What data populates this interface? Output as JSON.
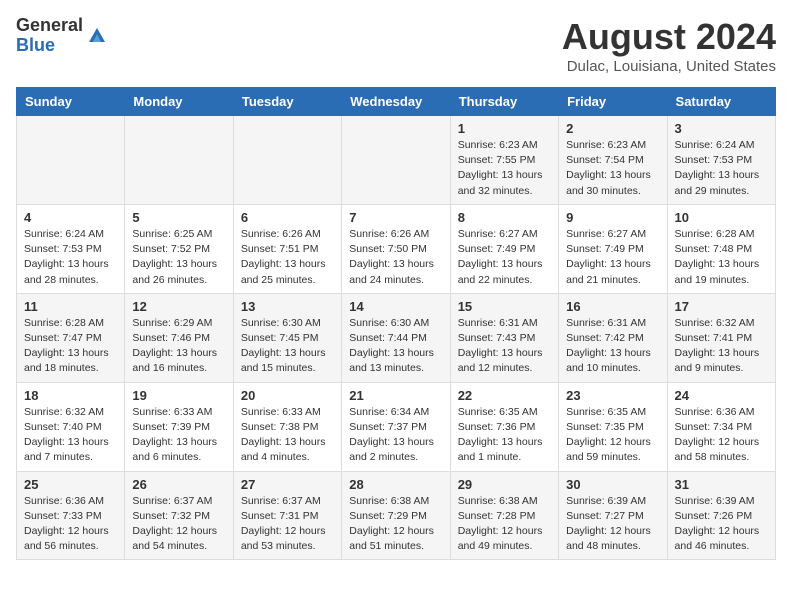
{
  "header": {
    "logo_general": "General",
    "logo_blue": "Blue",
    "month_title": "August 2024",
    "location": "Dulac, Louisiana, United States"
  },
  "weekdays": [
    "Sunday",
    "Monday",
    "Tuesday",
    "Wednesday",
    "Thursday",
    "Friday",
    "Saturday"
  ],
  "weeks": [
    [
      {
        "day": "",
        "info": ""
      },
      {
        "day": "",
        "info": ""
      },
      {
        "day": "",
        "info": ""
      },
      {
        "day": "",
        "info": ""
      },
      {
        "day": "1",
        "info": "Sunrise: 6:23 AM\nSunset: 7:55 PM\nDaylight: 13 hours\nand 32 minutes."
      },
      {
        "day": "2",
        "info": "Sunrise: 6:23 AM\nSunset: 7:54 PM\nDaylight: 13 hours\nand 30 minutes."
      },
      {
        "day": "3",
        "info": "Sunrise: 6:24 AM\nSunset: 7:53 PM\nDaylight: 13 hours\nand 29 minutes."
      }
    ],
    [
      {
        "day": "4",
        "info": "Sunrise: 6:24 AM\nSunset: 7:53 PM\nDaylight: 13 hours\nand 28 minutes."
      },
      {
        "day": "5",
        "info": "Sunrise: 6:25 AM\nSunset: 7:52 PM\nDaylight: 13 hours\nand 26 minutes."
      },
      {
        "day": "6",
        "info": "Sunrise: 6:26 AM\nSunset: 7:51 PM\nDaylight: 13 hours\nand 25 minutes."
      },
      {
        "day": "7",
        "info": "Sunrise: 6:26 AM\nSunset: 7:50 PM\nDaylight: 13 hours\nand 24 minutes."
      },
      {
        "day": "8",
        "info": "Sunrise: 6:27 AM\nSunset: 7:49 PM\nDaylight: 13 hours\nand 22 minutes."
      },
      {
        "day": "9",
        "info": "Sunrise: 6:27 AM\nSunset: 7:49 PM\nDaylight: 13 hours\nand 21 minutes."
      },
      {
        "day": "10",
        "info": "Sunrise: 6:28 AM\nSunset: 7:48 PM\nDaylight: 13 hours\nand 19 minutes."
      }
    ],
    [
      {
        "day": "11",
        "info": "Sunrise: 6:28 AM\nSunset: 7:47 PM\nDaylight: 13 hours\nand 18 minutes."
      },
      {
        "day": "12",
        "info": "Sunrise: 6:29 AM\nSunset: 7:46 PM\nDaylight: 13 hours\nand 16 minutes."
      },
      {
        "day": "13",
        "info": "Sunrise: 6:30 AM\nSunset: 7:45 PM\nDaylight: 13 hours\nand 15 minutes."
      },
      {
        "day": "14",
        "info": "Sunrise: 6:30 AM\nSunset: 7:44 PM\nDaylight: 13 hours\nand 13 minutes."
      },
      {
        "day": "15",
        "info": "Sunrise: 6:31 AM\nSunset: 7:43 PM\nDaylight: 13 hours\nand 12 minutes."
      },
      {
        "day": "16",
        "info": "Sunrise: 6:31 AM\nSunset: 7:42 PM\nDaylight: 13 hours\nand 10 minutes."
      },
      {
        "day": "17",
        "info": "Sunrise: 6:32 AM\nSunset: 7:41 PM\nDaylight: 13 hours\nand 9 minutes."
      }
    ],
    [
      {
        "day": "18",
        "info": "Sunrise: 6:32 AM\nSunset: 7:40 PM\nDaylight: 13 hours\nand 7 minutes."
      },
      {
        "day": "19",
        "info": "Sunrise: 6:33 AM\nSunset: 7:39 PM\nDaylight: 13 hours\nand 6 minutes."
      },
      {
        "day": "20",
        "info": "Sunrise: 6:33 AM\nSunset: 7:38 PM\nDaylight: 13 hours\nand 4 minutes."
      },
      {
        "day": "21",
        "info": "Sunrise: 6:34 AM\nSunset: 7:37 PM\nDaylight: 13 hours\nand 2 minutes."
      },
      {
        "day": "22",
        "info": "Sunrise: 6:35 AM\nSunset: 7:36 PM\nDaylight: 13 hours\nand 1 minute."
      },
      {
        "day": "23",
        "info": "Sunrise: 6:35 AM\nSunset: 7:35 PM\nDaylight: 12 hours\nand 59 minutes."
      },
      {
        "day": "24",
        "info": "Sunrise: 6:36 AM\nSunset: 7:34 PM\nDaylight: 12 hours\nand 58 minutes."
      }
    ],
    [
      {
        "day": "25",
        "info": "Sunrise: 6:36 AM\nSunset: 7:33 PM\nDaylight: 12 hours\nand 56 minutes."
      },
      {
        "day": "26",
        "info": "Sunrise: 6:37 AM\nSunset: 7:32 PM\nDaylight: 12 hours\nand 54 minutes."
      },
      {
        "day": "27",
        "info": "Sunrise: 6:37 AM\nSunset: 7:31 PM\nDaylight: 12 hours\nand 53 minutes."
      },
      {
        "day": "28",
        "info": "Sunrise: 6:38 AM\nSunset: 7:29 PM\nDaylight: 12 hours\nand 51 minutes."
      },
      {
        "day": "29",
        "info": "Sunrise: 6:38 AM\nSunset: 7:28 PM\nDaylight: 12 hours\nand 49 minutes."
      },
      {
        "day": "30",
        "info": "Sunrise: 6:39 AM\nSunset: 7:27 PM\nDaylight: 12 hours\nand 48 minutes."
      },
      {
        "day": "31",
        "info": "Sunrise: 6:39 AM\nSunset: 7:26 PM\nDaylight: 12 hours\nand 46 minutes."
      }
    ]
  ]
}
